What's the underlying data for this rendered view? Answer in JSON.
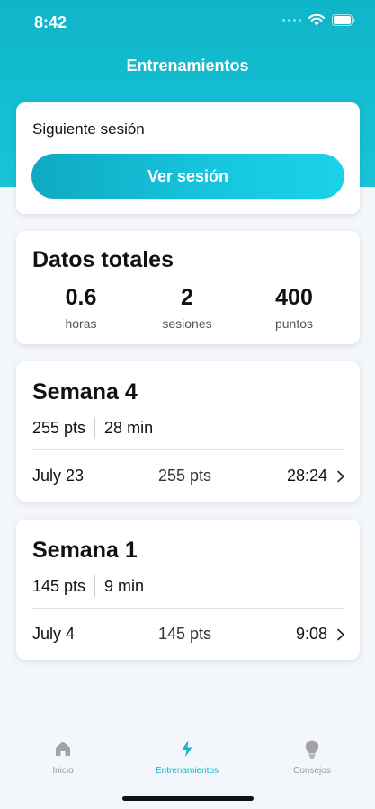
{
  "status_bar": {
    "time": "8:42"
  },
  "nav": {
    "title": "Entrenamientos"
  },
  "next_session": {
    "label": "Siguiente sesión",
    "button_label": "Ver sesión"
  },
  "totals": {
    "title": "Datos totales",
    "stats": [
      {
        "value": "0.6",
        "label": "horas"
      },
      {
        "value": "2",
        "label": "sesiones"
      },
      {
        "value": "400",
        "label": "puntos"
      }
    ]
  },
  "weeks": [
    {
      "title": "Semana 4",
      "points": "255 pts",
      "minutes": "28 min",
      "session": {
        "date": "July 23",
        "points": "255 pts",
        "duration": "28:24"
      }
    },
    {
      "title": "Semana 1",
      "points": "145 pts",
      "minutes": "9 min",
      "session": {
        "date": "July 4",
        "points": "145 pts",
        "duration": "9:08"
      }
    }
  ],
  "tabs": [
    {
      "label": "Inicio",
      "icon": "home-icon",
      "active": false
    },
    {
      "label": "Entrenamientos",
      "icon": "bolt-icon",
      "active": true
    },
    {
      "label": "Consejos",
      "icon": "lightbulb-icon",
      "active": false
    }
  ],
  "colors": {
    "accent": "#13b6cc",
    "header": "#19c4d8",
    "background": "#f3f6fa"
  }
}
